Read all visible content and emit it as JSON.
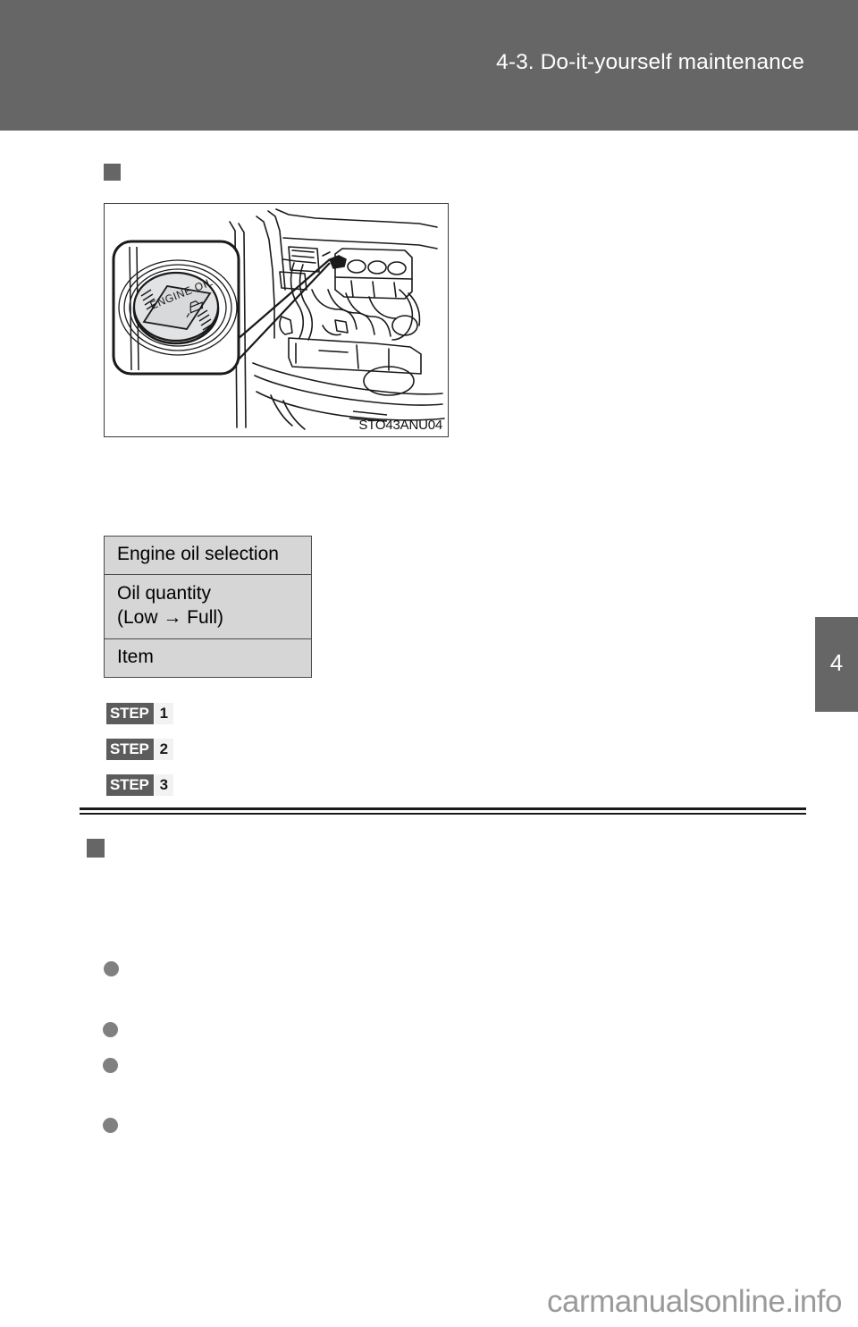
{
  "page": {
    "header_title": "4-3. Do-it-yourself maintenance",
    "chapter_tab": "4",
    "footer_watermark": "carmanualsonline.info"
  },
  "figure": {
    "caption": "STO43ANU04",
    "cap_label_line": "ENGINE OIL",
    "alt_name": "engine-oil-filler-cap-location"
  },
  "table": {
    "rows": [
      {
        "label": "Engine oil selection"
      },
      {
        "label": "Oil quantity",
        "label2": "(Low → Full)"
      },
      {
        "label": "Item"
      }
    ]
  },
  "steps": [
    {
      "word": "STEP",
      "number": "1"
    },
    {
      "word": "STEP",
      "number": "2"
    },
    {
      "word": "STEP",
      "number": "3"
    }
  ],
  "colors": {
    "header_band": "#666666",
    "table_cell": "#d6d6d6",
    "step_box": "#5c5c5c",
    "marker": "#666666",
    "bullet": "#808080",
    "watermark": "#9a9a9a"
  }
}
